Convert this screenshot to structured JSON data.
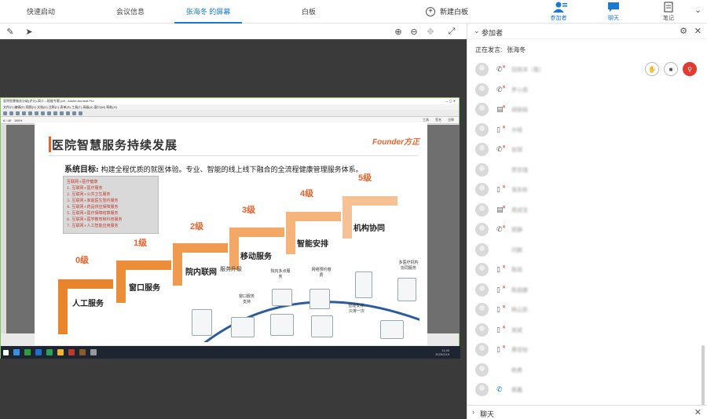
{
  "tabs": [
    {
      "label": "快速启动",
      "active": false
    },
    {
      "label": "会议信息",
      "active": false
    },
    {
      "label": "张海冬 的屏幕",
      "active": true
    },
    {
      "label": "白板",
      "active": false
    }
  ],
  "new_whiteboard": "新建白板",
  "top_buttons": {
    "participants": "参加者",
    "chat": "聊天",
    "notes": "笔记"
  },
  "panel": {
    "title": "参加者",
    "speaking_label": "正在发言:",
    "speaking_name": "张海冬",
    "chat_label": "聊天"
  },
  "participants": [
    {
      "device": "phone",
      "name": "田雨泽（我）",
      "self": true
    },
    {
      "device": "phone",
      "name": "罗小燕"
    },
    {
      "device": "screen",
      "name": "胡丽娟"
    },
    {
      "device": "mobile",
      "name": "许晓"
    },
    {
      "device": "phone",
      "name": "张琪"
    },
    {
      "device": "none",
      "name": "贾京瑞"
    },
    {
      "device": "mobile",
      "name": "邹永秋"
    },
    {
      "device": "screen",
      "name": "周成宝"
    },
    {
      "device": "phone",
      "name": "郭静"
    },
    {
      "device": "none",
      "name": "闫鹏"
    },
    {
      "device": "mobile",
      "name": "陈瑶"
    },
    {
      "device": "mobile",
      "name": "陈丽娜"
    },
    {
      "device": "mobile",
      "name": "韩云凯"
    },
    {
      "device": "mobile",
      "name": "吴斌"
    },
    {
      "device": "mobile",
      "name": "黄佳怡"
    },
    {
      "device": "none",
      "name": "杨勇"
    },
    {
      "device": "phone-blue",
      "name": "唐鑫"
    }
  ],
  "shared": {
    "window_title": "医院智慧服务分级(评分)-简介---赋能专题.pdf - Adobe Acrobat Pro",
    "menu": "文件(F)  编辑(E)  视图(V)  文档(D)  注释(C)  表单(R)  工具(T)  高级(A)  窗口(W)  帮助(H)",
    "nav_right": [
      "工具",
      "签名",
      "注释"
    ],
    "zoom": "186%",
    "page": "8 / 48",
    "taskbar_time": "11:40",
    "taskbar_date": "2020/2/19",
    "slide": {
      "title": "医院智慧服务持续发展",
      "logo": "Founder方正",
      "goal_label": "系统目标:",
      "goal_text": "构建全程优质的就医体验。专业、智能的线上线下融合的全流程健康管理服务体系。",
      "box_items": [
        "互联网+医疗健康",
        "1.    互联网+医疗服务",
        "2.    互联网+公共卫生服务",
        "3.    互联网+家庭医生签约服务",
        "4.    互联网+药品供应保障服务",
        "5.    互联网+医疗保障结算服务",
        "6.    互联网+医学教育和科普服务",
        "7.    互联网+人工智能应用服务"
      ],
      "levels": [
        "0级",
        "1级",
        "2级",
        "3级",
        "4级",
        "5级"
      ],
      "steps": [
        "人工服务",
        "窗口服务",
        "院内联网",
        "移动服务",
        "智能安排",
        "机构协同"
      ],
      "arrow_label": "服务升级",
      "figure_labels": [
        "窗口服务支持",
        "院内多点服务",
        "网络预约缴费",
        "智能安排,只排一次",
        "多医疗机构协同服务"
      ]
    }
  }
}
